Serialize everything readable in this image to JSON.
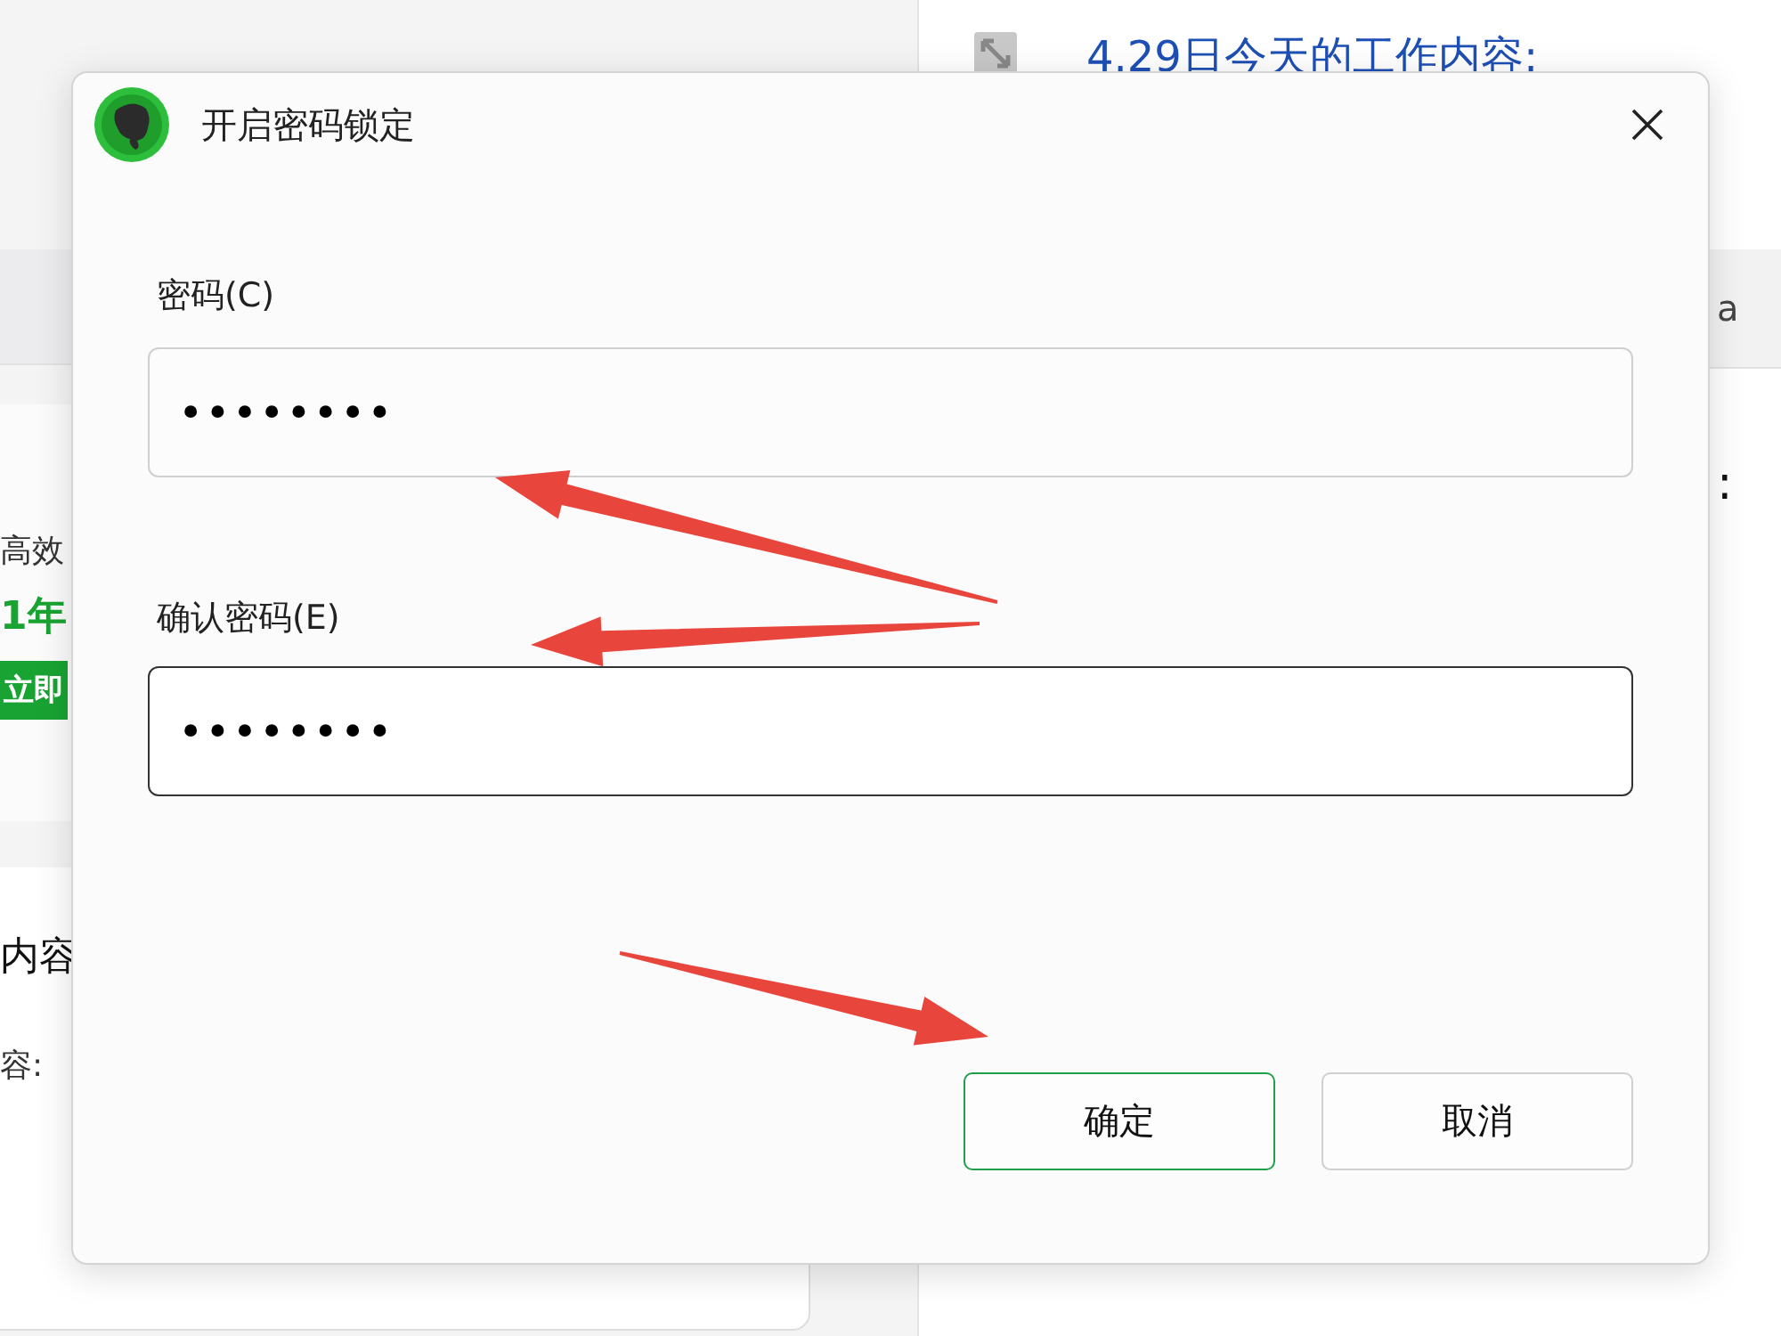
{
  "background": {
    "sidebar_texts": [
      {
        "kind": "text",
        "text": "高效"
      },
      {
        "kind": "promo",
        "text": "1年"
      },
      {
        "kind": "button",
        "text": "立即"
      },
      {
        "kind": "heading",
        "text": "内容"
      },
      {
        "kind": "text",
        "text": "容:"
      }
    ],
    "note_title": "4.29日今天的工作内容:",
    "note_texts": [
      {
        "kind": "text",
        "text": "a"
      },
      {
        "kind": "heading",
        "text": ":"
      }
    ]
  },
  "dialog": {
    "title": "开启密码锁定",
    "fields": [
      {
        "label": "密码(C)",
        "value": "••••••••",
        "focused": false
      },
      {
        "label": "确认密码(E)",
        "value": "••••••••",
        "focused": true
      }
    ],
    "buttons": [
      {
        "label": "确定",
        "default": true
      },
      {
        "label": "取消",
        "default": false
      }
    ]
  }
}
